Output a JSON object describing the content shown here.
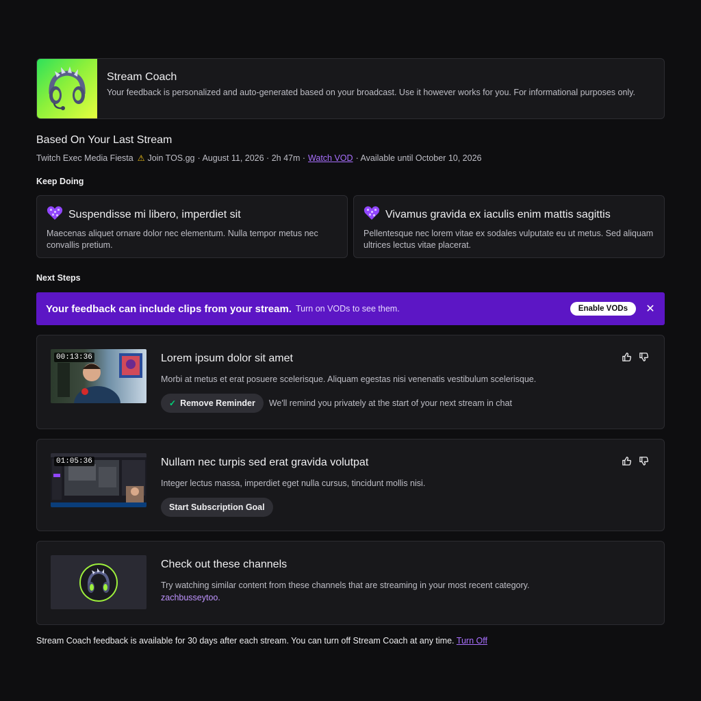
{
  "coach": {
    "title": "Stream Coach",
    "description": "Your feedback is personalized and auto-generated based on your broadcast. Use it however works for you. For informational purposes only."
  },
  "last_stream": {
    "heading": "Based On Your Last Stream",
    "title": "Twitch Exec Media Fiesta",
    "warn_icon": "warning-icon",
    "tag": "Join TOS.gg",
    "date": "· August 11, 2026 · 2h 47m ·",
    "vod_link": "Watch VOD",
    "availability": "· Available until October 10, 2026"
  },
  "keep_doing": {
    "label": "Keep Doing",
    "items": [
      {
        "title": "Suspendisse mi libero, imperdiet sit",
        "body": "Maecenas aliquet ornare dolor nec elementum. Nulla tempor metus nec convallis pretium."
      },
      {
        "title": "Vivamus gravida ex iaculis enim mattis sagittis",
        "body": "Pellentesque nec lorem vitae ex sodales vulputate eu ut metus. Sed aliquam ultrices lectus vitae placerat."
      }
    ]
  },
  "next_steps": {
    "label": "Next Steps",
    "banner": {
      "strong": "Your feedback can include clips from your stream.",
      "sub": "Turn on VODs to see them.",
      "button": "Enable VODs",
      "close": "✕"
    },
    "steps": [
      {
        "timestamp": "00:13:36",
        "title": "Lorem ipsum dolor sit amet",
        "description": "Morbi at metus et erat posuere scelerisque. Aliquam egestas nisi venenatis vestibulum scelerisque.",
        "button": "Remove Reminder",
        "note": "We'll remind you privately at the start of your next stream in chat"
      },
      {
        "timestamp": "01:05:36",
        "title": "Nullam nec turpis sed erat gravida volutpat",
        "description": "Integer lectus massa, imperdiet eget nulla cursus, tincidunt mollis nisi.",
        "button": "Start Subscription Goal"
      },
      {
        "title": "Check out these channels",
        "description": "Try watching similar content from these channels that are streaming in your most recent category.",
        "channel": "zachbusseytoo."
      }
    ]
  },
  "footer": {
    "text": "Stream Coach feedback is available for 30 days after each stream. You can turn off Stream Coach at any time.",
    "link": "Turn Off"
  },
  "colors": {
    "accent": "#a970ff",
    "banner": "#5c16c5",
    "background": "#0e0e10",
    "card": "#18181b"
  }
}
